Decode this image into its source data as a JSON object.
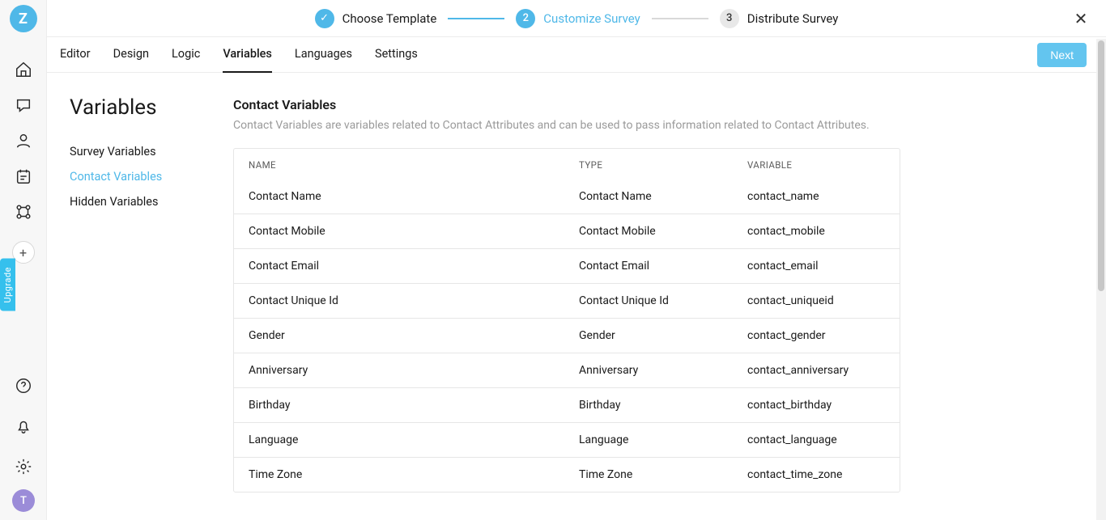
{
  "rail": {
    "logo_letter": "Z",
    "upgrade_label": "Upgrade",
    "add_glyph": "+",
    "avatar_letter": "T"
  },
  "stepper": {
    "steps": [
      {
        "label": "Choose Template",
        "badge": "✓"
      },
      {
        "label": "Customize Survey",
        "badge": "2"
      },
      {
        "label": "Distribute Survey",
        "badge": "3"
      }
    ]
  },
  "tabs": {
    "items": [
      {
        "label": "Editor"
      },
      {
        "label": "Design"
      },
      {
        "label": "Logic"
      },
      {
        "label": "Variables"
      },
      {
        "label": "Languages"
      },
      {
        "label": "Settings"
      }
    ],
    "next_label": "Next"
  },
  "sidebar": {
    "title": "Variables",
    "items": [
      {
        "label": "Survey Variables"
      },
      {
        "label": "Contact Variables"
      },
      {
        "label": "Hidden Variables"
      }
    ]
  },
  "main": {
    "title": "Contact Variables",
    "desc": "Contact Variables are variables related to Contact Attributes and can be used to pass information related to Contact Attributes.",
    "table": {
      "headers": {
        "name": "NAME",
        "type": "TYPE",
        "variable": "VARIABLE"
      },
      "rows": [
        {
          "name": "Contact Name",
          "type": "Contact Name",
          "variable": "contact_name"
        },
        {
          "name": "Contact Mobile",
          "type": "Contact Mobile",
          "variable": "contact_mobile"
        },
        {
          "name": "Contact Email",
          "type": "Contact Email",
          "variable": "contact_email"
        },
        {
          "name": "Contact Unique Id",
          "type": "Contact Unique Id",
          "variable": "contact_uniqueid"
        },
        {
          "name": "Gender",
          "type": "Gender",
          "variable": "contact_gender"
        },
        {
          "name": "Anniversary",
          "type": "Anniversary",
          "variable": "contact_anniversary"
        },
        {
          "name": "Birthday",
          "type": "Birthday",
          "variable": "contact_birthday"
        },
        {
          "name": "Language",
          "type": "Language",
          "variable": "contact_language"
        },
        {
          "name": "Time Zone",
          "type": "Time Zone",
          "variable": "contact_time_zone"
        }
      ]
    }
  }
}
